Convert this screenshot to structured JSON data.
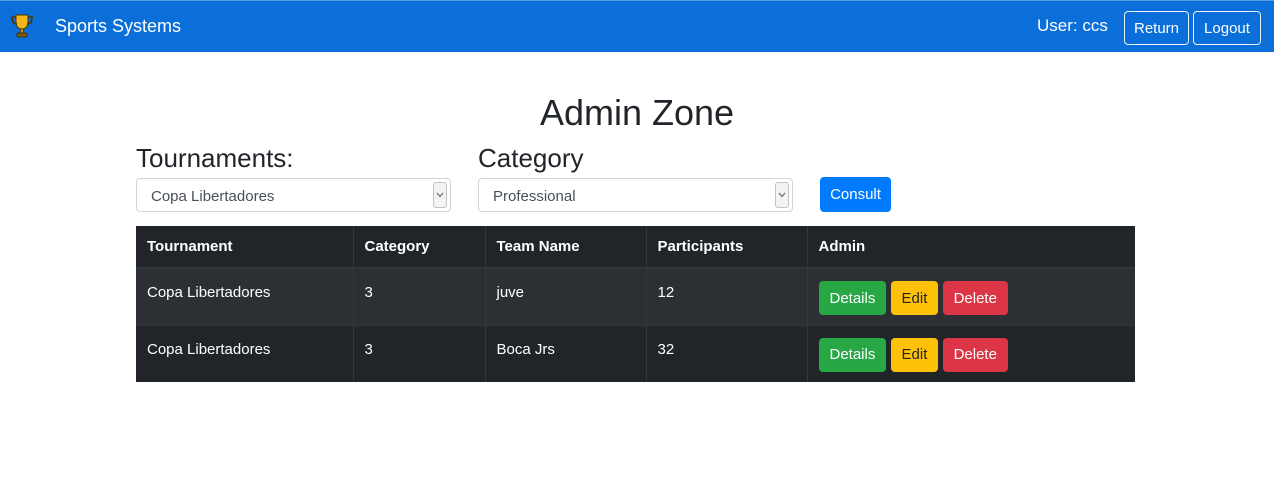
{
  "navbar": {
    "brand": "Sports Systems",
    "user_text": "User: ccs",
    "return_label": "Return",
    "logout_label": "Logout",
    "icon": "trophy-icon",
    "bg_color": "#0b6fd9"
  },
  "page": {
    "title": "Admin Zone"
  },
  "filters": {
    "tournaments_label": "Tournaments:",
    "tournaments_value": "Copa Libertadores",
    "category_label": "Category",
    "category_value": "Professional",
    "consult_label": "Consult"
  },
  "table": {
    "headers": [
      "Tournament",
      "Category",
      "Team Name",
      "Participants",
      "Admin"
    ],
    "rows": [
      [
        "Copa Libertadores",
        "3",
        "juve",
        "12"
      ],
      [
        "Copa Libertadores",
        "3",
        "Boca Jrs",
        "32"
      ]
    ],
    "actions": {
      "details": "Details",
      "edit": "Edit",
      "delete": "Delete"
    }
  },
  "colors": {
    "primary": "#007bff",
    "success": "#28a745",
    "warning": "#ffc107",
    "danger": "#dc3545",
    "table_dark": "#212529"
  }
}
